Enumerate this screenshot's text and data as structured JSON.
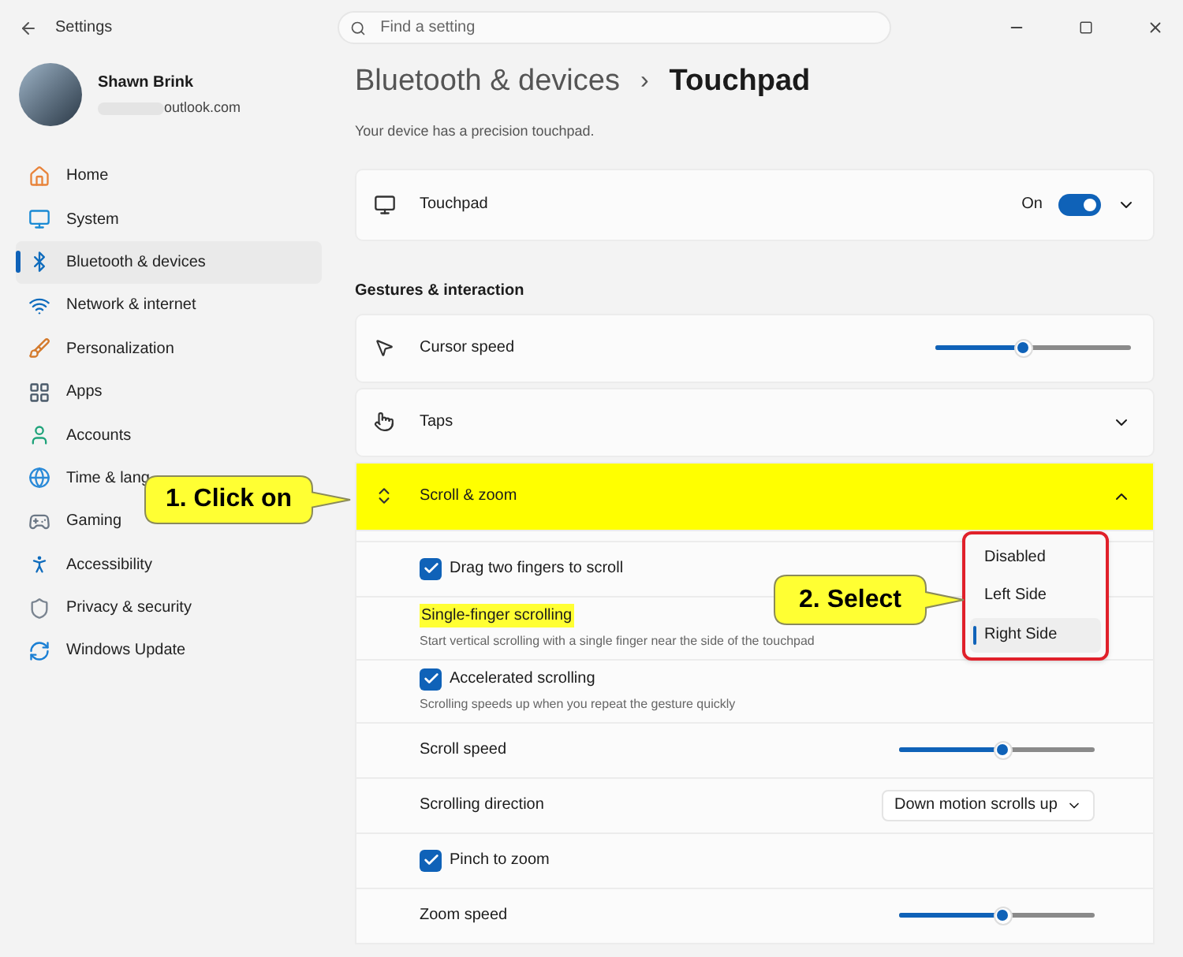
{
  "window": {
    "title": "Settings",
    "search_placeholder": "Find a setting"
  },
  "user": {
    "name": "Shawn Brink",
    "email": "outlook.com"
  },
  "sidebar": {
    "items": [
      {
        "label": "Home",
        "selected": false
      },
      {
        "label": "System",
        "selected": false
      },
      {
        "label": "Bluetooth & devices",
        "selected": true
      },
      {
        "label": "Network & internet",
        "selected": false
      },
      {
        "label": "Personalization",
        "selected": false
      },
      {
        "label": "Apps",
        "selected": false
      },
      {
        "label": "Accounts",
        "selected": false
      },
      {
        "label": "Time & lang",
        "selected": false
      },
      {
        "label": "Gaming",
        "selected": false
      },
      {
        "label": "Accessibility",
        "selected": false
      },
      {
        "label": "Privacy & security",
        "selected": false
      },
      {
        "label": "Windows Update",
        "selected": false
      }
    ]
  },
  "breadcrumb": {
    "parent": "Bluetooth & devices",
    "separator": "›",
    "current": "Touchpad"
  },
  "description": "Your device has a precision touchpad.",
  "touchpad": {
    "label": "Touchpad",
    "state_text": "On",
    "on": true,
    "expanded": false
  },
  "section_heading": "Gestures & interaction",
  "cards": [
    {
      "kind": "slider",
      "label": "Cursor speed",
      "level": 0.45
    },
    {
      "kind": "expander",
      "label": "Taps",
      "expanded": false,
      "highlighted": false
    },
    {
      "kind": "expander",
      "label": "Scroll & zoom",
      "expanded": true,
      "highlighted": true
    }
  ],
  "scroll_settings": [
    {
      "kind": "checkbox",
      "label": "Drag two fingers to scroll",
      "checked": true
    },
    {
      "kind": "text",
      "label": "Single-finger scrolling",
      "description": "Start vertical scrolling with a single finger near the side of the touchpad",
      "highlighted": true
    },
    {
      "kind": "checkbox",
      "label": "Accelerated scrolling",
      "checked": true,
      "description": "Scrolling speeds up when you repeat the gesture quickly"
    },
    {
      "kind": "slider",
      "label": "Scroll speed",
      "level": 0.53
    },
    {
      "kind": "dropdown",
      "label": "Scrolling direction",
      "value": "Down motion scrolls up"
    },
    {
      "kind": "checkbox",
      "label": "Pinch to zoom",
      "checked": true
    },
    {
      "kind": "slider",
      "label": "Zoom speed",
      "level": 0.53
    }
  ],
  "dropdown_menu": {
    "options": [
      {
        "label": "Disabled",
        "selected": false
      },
      {
        "label": "Left Side",
        "selected": false
      },
      {
        "label": "Right Side",
        "selected": true
      }
    ]
  },
  "callouts": [
    {
      "text": "1. Click on"
    },
    {
      "text": "2. Select"
    }
  ]
}
